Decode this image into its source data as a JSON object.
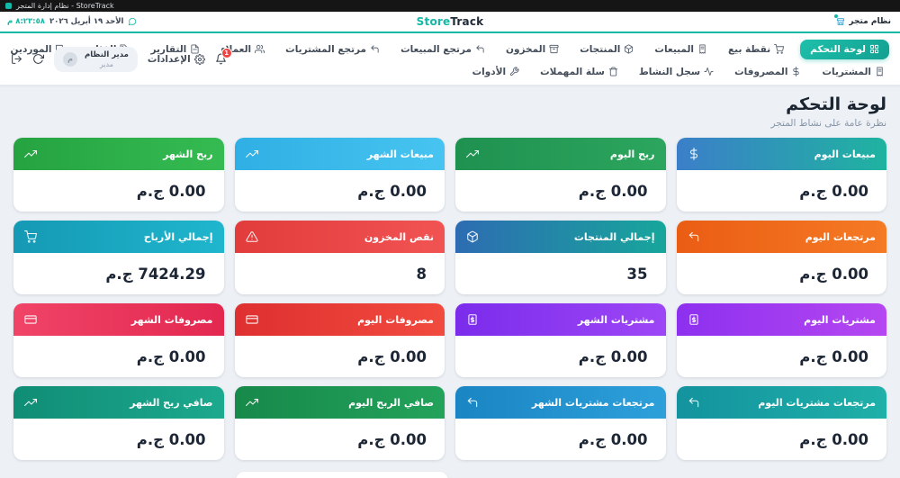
{
  "window": {
    "title": "نظام إدارة المتجر - StoreTrack"
  },
  "header": {
    "date": "الأحد ١٩ أبريل ٢٠٢٦",
    "time": "٨:٢٣:٥٨ م",
    "logo_store": "Store",
    "logo_track": "Track",
    "system_badge": "نظام متجر",
    "accent_color": "#14b8a6"
  },
  "nav": {
    "row1": [
      {
        "label": "لوحة التحكم",
        "icon": "grid",
        "active": true
      },
      {
        "label": "نقطة بيع",
        "icon": "cart",
        "active": false
      },
      {
        "label": "المبيعات",
        "icon": "receipt",
        "active": false
      },
      {
        "label": "المنتجات",
        "icon": "package",
        "active": false
      },
      {
        "label": "المخزون",
        "icon": "box",
        "active": false
      },
      {
        "label": "مرتجع المبيعات",
        "icon": "undo",
        "active": false
      },
      {
        "label": "مرتجع المشتريات",
        "icon": "undo",
        "active": false
      },
      {
        "label": "العملاء",
        "icon": "users",
        "active": false
      },
      {
        "label": "التقارير",
        "icon": "file",
        "active": false
      },
      {
        "label": "الفئات",
        "icon": "tag",
        "active": false
      },
      {
        "label": "الموردين",
        "icon": "truck",
        "active": false
      }
    ],
    "row2": [
      {
        "label": "المشتريات",
        "icon": "receipt",
        "active": false
      },
      {
        "label": "المصروفات",
        "icon": "dollar",
        "active": false
      },
      {
        "label": "سجل النشاط",
        "icon": "activity",
        "active": false
      },
      {
        "label": "سلة المهملات",
        "icon": "trash",
        "active": false
      },
      {
        "label": "الأدوات",
        "icon": "wrench",
        "active": false
      }
    ],
    "settings_label": "الإعدادات",
    "notification_count": "1"
  },
  "user": {
    "name": "مدير النظام",
    "role": "مدير",
    "avatar_letter": "م"
  },
  "page": {
    "title": "لوحة التحكم",
    "subtitle": "نظرة عامة على نشاط المتجر"
  },
  "cards": [
    {
      "title": "مبيعات اليوم",
      "value": "0.00 ج.م",
      "icon": "dollar",
      "colors": [
        "#1fb3a0",
        "#3b7fc9"
      ]
    },
    {
      "title": "ربح اليوم",
      "value": "0.00 ج.م",
      "icon": "trending",
      "colors": [
        "#2ca65e",
        "#1f9150"
      ]
    },
    {
      "title": "مبيعات الشهر",
      "value": "0.00 ج.م",
      "icon": "trending",
      "colors": [
        "#47c4f0",
        "#2fafe4"
      ]
    },
    {
      "title": "ربح الشهر",
      "value": "0.00 ج.م",
      "icon": "trending",
      "colors": [
        "#35bb52",
        "#25a341"
      ]
    },
    {
      "title": "مرتجعات اليوم",
      "value": "0.00 ج.م",
      "icon": "undo",
      "colors": [
        "#f57a24",
        "#ea5d14"
      ]
    },
    {
      "title": "إجمالي المنتجات",
      "value": "35",
      "icon": "package",
      "colors": [
        "#17a69b",
        "#2d6cb2"
      ]
    },
    {
      "title": "نقص المخزون",
      "value": "8",
      "icon": "alert",
      "colors": [
        "#f15353",
        "#e23c3c"
      ]
    },
    {
      "title": "إجمالي الأرباح",
      "value": "7424.29 ج.م",
      "icon": "cart",
      "colors": [
        "#1fb6cd",
        "#1599b4"
      ]
    },
    {
      "title": "مشتريات اليوم",
      "value": "0.00 ج.م",
      "icon": "receipt-dollar",
      "colors": [
        "#b547f1",
        "#8d30ef"
      ]
    },
    {
      "title": "مشتريات الشهر",
      "value": "0.00 ج.م",
      "icon": "receipt-dollar",
      "colors": [
        "#9d46f6",
        "#7b2ceb"
      ]
    },
    {
      "title": "مصروفات اليوم",
      "value": "0.00 ج.م",
      "icon": "wallet",
      "colors": [
        "#f14a3e",
        "#de3030"
      ]
    },
    {
      "title": "مصروفات الشهر",
      "value": "0.00 ج.م",
      "icon": "wallet",
      "colors": [
        "#e32850",
        "#f04467"
      ]
    },
    {
      "title": "مرتجعات مشتريات اليوم",
      "value": "0.00 ج.م",
      "icon": "undo",
      "colors": [
        "#1fb0a8",
        "#13939e"
      ]
    },
    {
      "title": "مرتجعات مشتريات الشهر",
      "value": "0.00 ج.م",
      "icon": "undo",
      "colors": [
        "#2da0da",
        "#1a85c3"
      ]
    },
    {
      "title": "صافي الربح اليوم",
      "value": "0.00 ج.م",
      "icon": "trending",
      "colors": [
        "#23a25b",
        "#17894a"
      ]
    },
    {
      "title": "صافي ربح الشهر",
      "value": "0.00 ج.م",
      "icon": "trending",
      "colors": [
        "#1ca98e",
        "#108d75"
      ]
    }
  ]
}
